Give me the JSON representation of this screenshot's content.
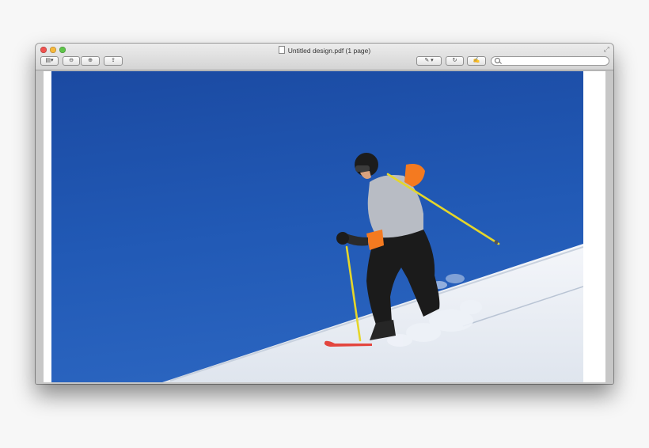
{
  "window": {
    "title": "Untitled design.pdf (1 page)"
  },
  "toolbar": {
    "sidebar_icon": "sidebar-icon",
    "zoom_out_icon": "zoom-out-icon",
    "zoom_in_icon": "zoom-in-icon",
    "share_icon": "share-icon",
    "annotate_icon": "pen-icon",
    "rotate_icon": "rotate-icon",
    "edit_icon": "edit-icon",
    "search_placeholder": ""
  },
  "document": {
    "image": "skier-on-snow-slope-photo",
    "colors": {
      "sky": "#1e4fa8",
      "snow": "#f2f4f8",
      "jacket_accent": "#f47a20",
      "poles": "#e5d62a"
    }
  }
}
